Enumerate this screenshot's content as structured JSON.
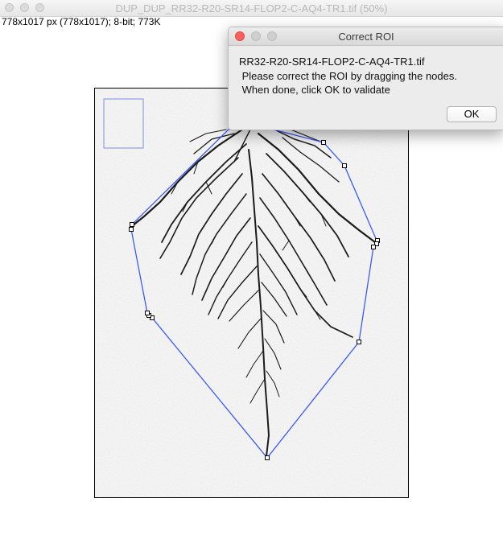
{
  "window": {
    "title": "DUP_DUP_RR32-R20-SR14-FLOP2-C-AQ4-TR1.tif (50%)",
    "info": "778x1017 px (778x1017); 8-bit; 773K"
  },
  "dialog": {
    "title": "Correct ROI",
    "line1": "RR32-R20-SR14-FLOP2-C-AQ4-TR1.tif",
    "line2": " Please correct the ROI by dragging the nodes.",
    "line3": " When done, click OK to validate",
    "ok_label": "OK"
  },
  "colors": {
    "roi_line": "#2f4fff",
    "root": "#1b1b1b",
    "image_background": "#d7d7d7",
    "close_red": "#fc605c"
  },
  "icons": [
    "window-close-icon",
    "window-minimize-icon",
    "window-zoom-icon",
    "roi-node-icon"
  ]
}
